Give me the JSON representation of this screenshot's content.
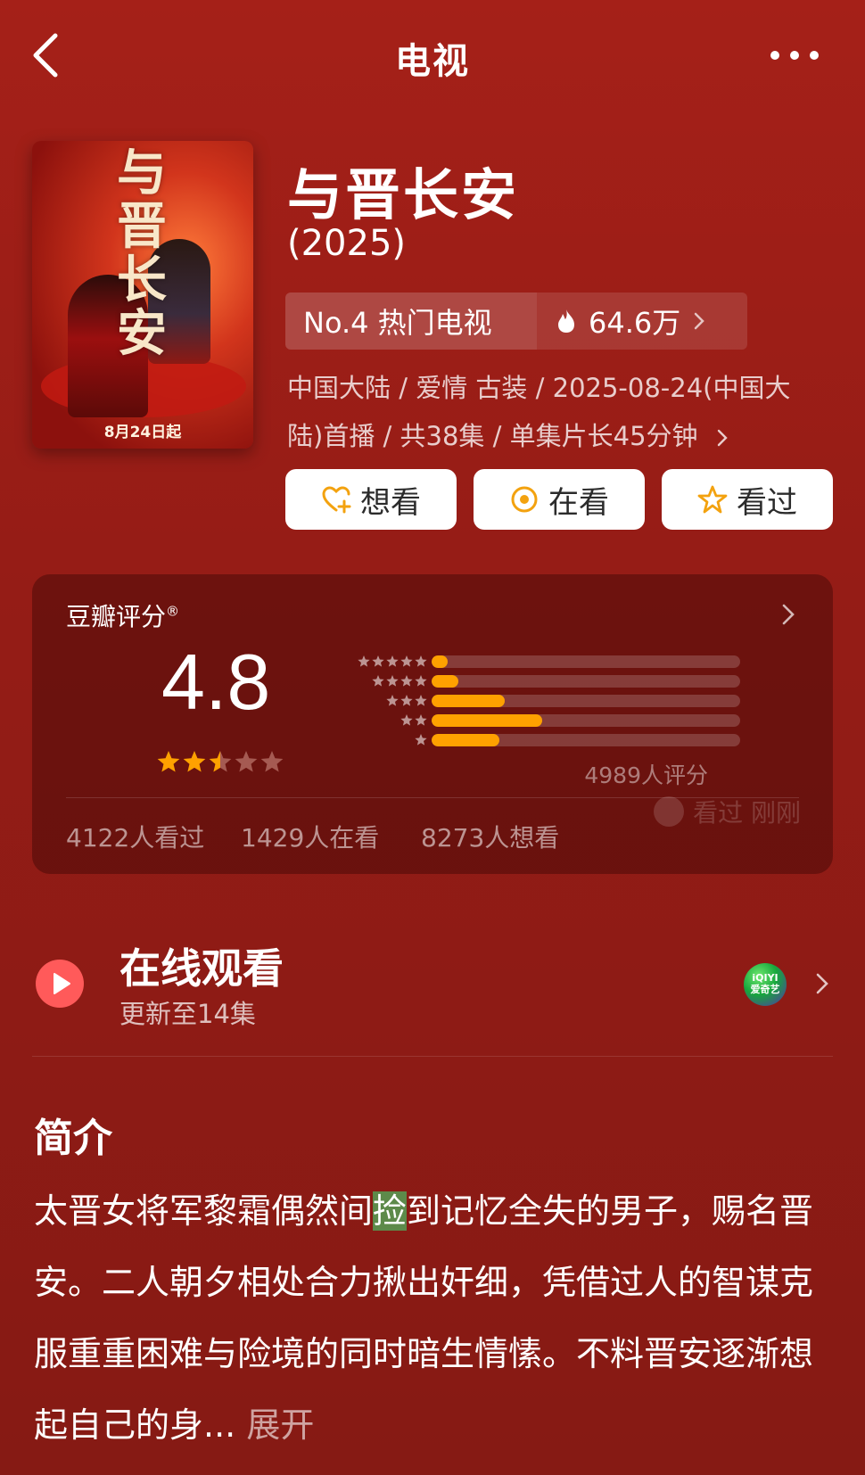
{
  "header": {
    "title": "电视"
  },
  "poster": {
    "title_art": "与晋长安",
    "date_text": "8月24日起"
  },
  "show": {
    "title": "与晋长安",
    "year": "(2025)",
    "rank_text": "No.4 热门电视",
    "heat_text": "64.6万",
    "meta_line1": "中国大陆 / 爱情 古装 / 2025-08-24(中国大",
    "meta_line2": "陆)首播 / 共38集 / 单集片长45分钟"
  },
  "actions": {
    "want": "想看",
    "watching": "在看",
    "watched": "看过"
  },
  "rating": {
    "label": "豆瓣评分",
    "registered_mark": "®",
    "score": "4.8",
    "score_stars": 2.5,
    "distribution": [
      {
        "stars": 5,
        "percent": 5.2
      },
      {
        "stars": 4,
        "percent": 8.7
      },
      {
        "stars": 3,
        "percent": 23.7
      },
      {
        "stars": 2,
        "percent": 35.8
      },
      {
        "stars": 1,
        "percent": 21.9
      }
    ],
    "count_text": "4989人评分",
    "watched_text": "4122人看过",
    "watching_text": "1429人在看",
    "want_text": "8273人想看",
    "watermark": "看过 刚刚"
  },
  "online": {
    "title": "在线观看",
    "subtitle": "更新至14集",
    "platform_logo_text": "iQIYI\n爱奇艺"
  },
  "synopsis": {
    "title": "简介",
    "before": "太晋女将军黎霜偶然间",
    "highlight": "捡",
    "after": "到记忆全失的男子，赐名晋安。二人朝夕相处合力揪出奸细，凭借过人的智谋克服重重困难与险境的同时暗生情愫。不料晋安逐渐想起自己的身...",
    "expand": " 展开"
  },
  "colors": {
    "background": "#951c16",
    "accent_orange": "#ffa100",
    "button_bg": "#ffffff"
  }
}
